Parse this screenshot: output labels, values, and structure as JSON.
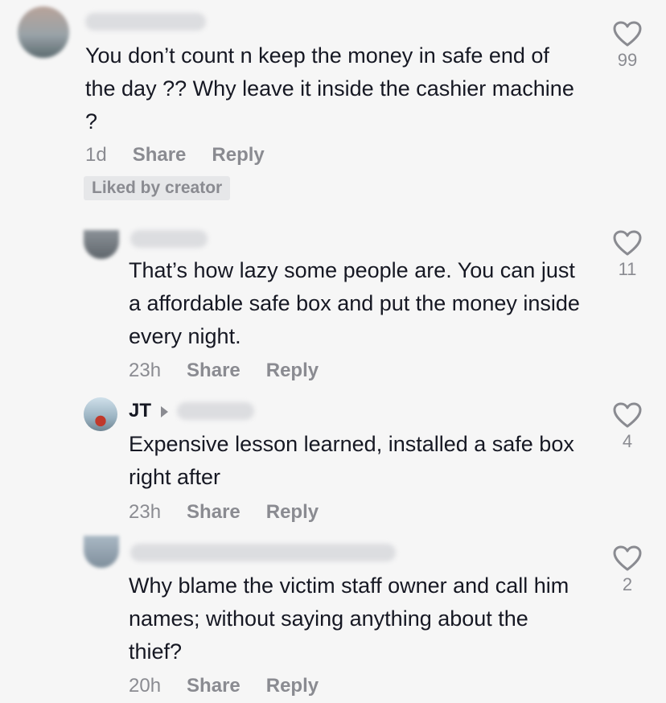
{
  "comments": [
    {
      "text": "You don’t count n keep the money in safe end of the day ?? Why leave it inside the cashier machine ?",
      "time": "1d",
      "share": "Share",
      "reply": "Reply",
      "badge": "Liked by creator",
      "likes": "99"
    },
    {
      "text": "That’s how lazy some people are. You can just a affordable safe box and put the money inside every night.",
      "time": "23h",
      "share": "Share",
      "reply": "Reply",
      "likes": "11"
    },
    {
      "username": "JT",
      "text": "Expensive lesson learned, installed a safe box right after",
      "time": "23h",
      "share": "Share",
      "reply": "Reply",
      "likes": "4"
    },
    {
      "text": "Why blame the victim staff owner and call him names; without saying anything about the thief?",
      "time": "20h",
      "share": "Share",
      "reply": "Reply",
      "likes": "2"
    }
  ],
  "icons": {
    "like": "heart-outline-icon",
    "reply_to": "caret-right-icon"
  },
  "colors": {
    "background": "#f6f6f6",
    "text": "#161823",
    "muted": "#8a8b91"
  }
}
